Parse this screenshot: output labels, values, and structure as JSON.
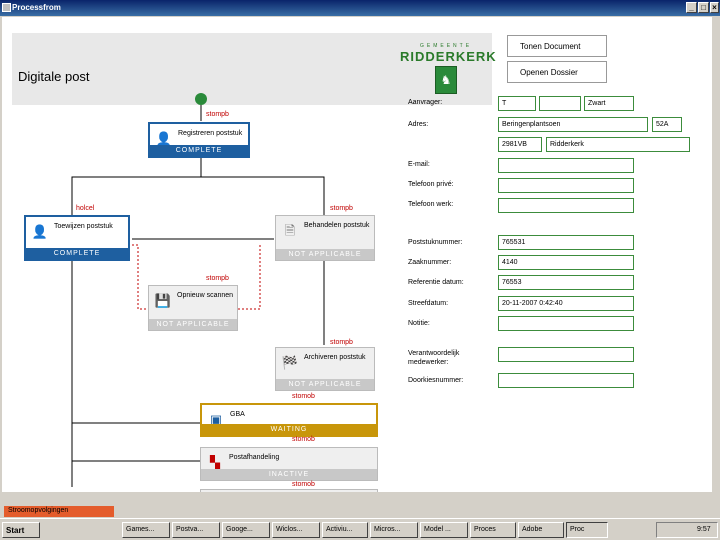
{
  "window": {
    "title": "Processfrom"
  },
  "header": {
    "app_title": "Digitale post",
    "logo_small": "GEMEENTE",
    "logo_name": "RIDDERKERK",
    "btn_open_document": "Tonen Document",
    "btn_open_dossier": "Openen Dossier"
  },
  "flow": {
    "users": [
      "stompb",
      "holcel",
      "stompb",
      "stompb",
      "stompb",
      "stomob",
      "stomob",
      "stomob"
    ],
    "nodes": [
      {
        "label": "Registreren poststuk",
        "status": "COMPLETE",
        "icon": "person-icon"
      },
      {
        "label": "Toewijzen poststuk",
        "status": "COMPLETE",
        "icon": "person-icon"
      },
      {
        "label": "Behandelen poststuk",
        "status": "NOT APPLICABLE",
        "icon": "document-icon"
      },
      {
        "label": "Opnieuw scannen",
        "status": "NOT APPLICABLE",
        "icon": "disk-icon"
      },
      {
        "label": "Archiveren poststuk",
        "status": "NOT APPLICABLE",
        "icon": "checkered-flag-icon"
      },
      {
        "label": "GBA",
        "status": "WAITING",
        "icon": "window-icon"
      },
      {
        "label": "Postafhandeling",
        "status": "INACTIVE",
        "icon": "network-icon"
      }
    ]
  },
  "form": {
    "fields": [
      {
        "label": "Aanvrager:",
        "values": [
          "T",
          "",
          "Zwart"
        ]
      },
      {
        "label": "Adres:",
        "values": [
          "Beringenplantsoen",
          "52A"
        ]
      },
      {
        "label": "",
        "values": [
          "2981VB",
          "Ridderkerk"
        ]
      },
      {
        "label": "E-mail:",
        "values": [
          ""
        ]
      },
      {
        "label": "Telefoon privé:",
        "values": [
          ""
        ]
      },
      {
        "label": "Telefoon werk:",
        "values": [
          ""
        ]
      },
      {
        "label": "Poststuknummer:",
        "values": [
          "765531"
        ]
      },
      {
        "label": "Zaaknummer:",
        "values": [
          "4140"
        ]
      },
      {
        "label": "Referentie datum:",
        "values": [
          "76553"
        ]
      },
      {
        "label": "Streefdatum:",
        "values": [
          "20-11-2007 0:42:40"
        ]
      },
      {
        "label": "Notitie:",
        "values": [
          ""
        ]
      },
      {
        "label": "Verantwoordelijk medewerker:",
        "values": [
          ""
        ]
      },
      {
        "label": "Doorkiesnummer:",
        "values": [
          ""
        ]
      }
    ]
  },
  "sheet_tab": "Stroomopvolgingen",
  "taskbar": {
    "start": "Start",
    "items": [
      "Games...",
      "Postva...",
      "Googe...",
      "Wiclos...",
      "Activiu...",
      "Micros...",
      "Model ...",
      "Proces",
      "Adobe",
      "Proc"
    ],
    "clock": "9:57"
  },
  "colors": {
    "complete": "#1e5fa0",
    "waiting": "#c8960a",
    "user": "#c00000",
    "field_border": "#3c8c3c"
  }
}
